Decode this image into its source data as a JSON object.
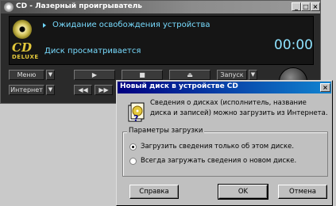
{
  "player": {
    "title": "CD - Лазерный проигрыватель",
    "controls": {
      "minimize": "_",
      "maximize": "□",
      "close": "×"
    },
    "display": {
      "status_line": "Ожидание освобождения устройства",
      "track_status": "Диск просматривается",
      "time": "00:00",
      "logo_top": "CD",
      "logo_bottom": "DELUXE"
    },
    "buttons": {
      "menu": "Меню",
      "internet": "Интернет",
      "play": "▶",
      "stop": "■",
      "eject": "⏏",
      "prev": "◀◀",
      "next": "▶▶",
      "options": "Запуск",
      "dropdown": "▼"
    }
  },
  "dialog": {
    "title": "Новый диск в устройстве CD",
    "close": "×",
    "message": "Сведения о дисках (исполнитель, название диска и записей) можно загрузить из Интернета.",
    "group_label": "Параметры загрузки",
    "options": [
      {
        "label": "Загрузить сведения только об этом диске.",
        "checked": true
      },
      {
        "label": "Всегда загружать сведения о новом диске.",
        "checked": false
      }
    ],
    "buttons": {
      "help": "Справка",
      "ok": "OK",
      "cancel": "Отмена"
    }
  }
}
